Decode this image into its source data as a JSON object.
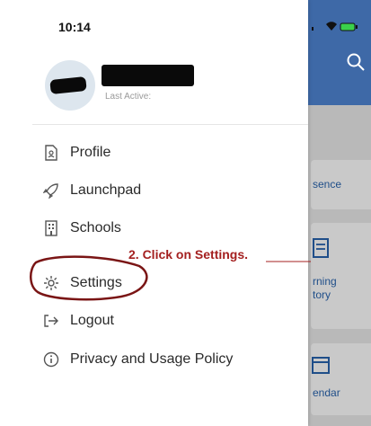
{
  "status_bar": {
    "time": "10:14"
  },
  "user": {
    "last_active_label": "Last Active:"
  },
  "menu": {
    "items": [
      {
        "label": "Profile",
        "icon": "profile-document-icon"
      },
      {
        "label": "Launchpad",
        "icon": "rocket-icon"
      },
      {
        "label": "Schools",
        "icon": "building-icon"
      },
      {
        "label": "Settings",
        "icon": "gear-icon"
      },
      {
        "label": "Logout",
        "icon": "logout-icon"
      },
      {
        "label": "Privacy and Usage Policy",
        "icon": "info-icon"
      }
    ]
  },
  "annotation": {
    "text": "2. Click on Settings.",
    "color": "#a42020"
  },
  "background_app": {
    "header_color": "#3e69a7",
    "cards": [
      {
        "text": "sence"
      },
      {
        "text_line1": "rning",
        "text_line2": "tory"
      },
      {
        "text": "endar"
      }
    ]
  }
}
